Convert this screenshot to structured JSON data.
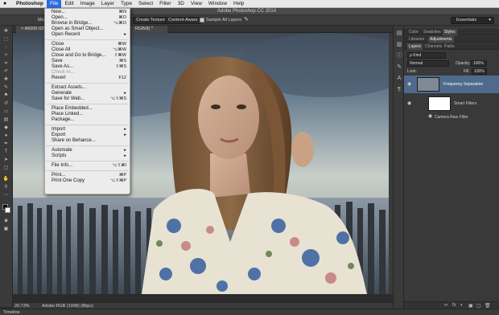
{
  "menubar": {
    "app": "Photoshop",
    "items": [
      "File",
      "Edit",
      "Image",
      "Layer",
      "Type",
      "Select",
      "Filter",
      "3D",
      "View",
      "Window",
      "Help"
    ]
  },
  "window_title": "Adobe Photoshop CC 2014",
  "options": {
    "mode_label": "Mo",
    "texture_button": "Create Texture",
    "content_aware_button": "Content-Aware",
    "sample_all_layers": "Sample All Layers",
    "workspace": "Essentials"
  },
  "document_tab": {
    "title": "A6000-025...",
    "suffix": "RGB/8) *"
  },
  "status": {
    "zoom": "20.73%",
    "profile": "Adobe RGB (1998) (8bpc)"
  },
  "timeline_label": "Timeline",
  "file_menu": {
    "items": [
      {
        "label": "New...",
        "shortcut": "⌘N"
      },
      {
        "label": "Open...",
        "shortcut": "⌘O"
      },
      {
        "label": "Browse in Bridge...",
        "shortcut": "⌥⌘O"
      },
      {
        "label": "Open as Smart Object...",
        "shortcut": ""
      },
      {
        "label": "Open Recent",
        "shortcut": "▸"
      },
      {
        "label": "Close",
        "shortcut": "⌘W"
      },
      {
        "label": "Close All",
        "shortcut": "⌥⌘W"
      },
      {
        "label": "Close and Go to Bridge...",
        "shortcut": "⇧⌘W"
      },
      {
        "label": "Save",
        "shortcut": "⌘S"
      },
      {
        "label": "Save As...",
        "shortcut": "⇧⌘S"
      },
      {
        "label": "Check In...",
        "shortcut": ""
      },
      {
        "label": "Revert",
        "shortcut": "F12"
      },
      {
        "label": "Extract Assets...",
        "shortcut": ""
      },
      {
        "label": "Generate",
        "shortcut": "▸"
      },
      {
        "label": "Save for Web...",
        "shortcut": "⌥⇧⌘S"
      },
      {
        "label": "Place Embedded...",
        "shortcut": ""
      },
      {
        "label": "Place Linked...",
        "shortcut": ""
      },
      {
        "label": "Package...",
        "shortcut": ""
      },
      {
        "label": "Import",
        "shortcut": "▸"
      },
      {
        "label": "Export",
        "shortcut": "▸"
      },
      {
        "label": "Share on Behance...",
        "shortcut": ""
      },
      {
        "label": "Automate",
        "shortcut": "▸"
      },
      {
        "label": "Scripts",
        "shortcut": "▸"
      },
      {
        "label": "File Info...",
        "shortcut": "⌥⇧⌘I"
      },
      {
        "label": "Print...",
        "shortcut": "⌘P"
      },
      {
        "label": "Print One Copy",
        "shortcut": "⌥⇧⌘P"
      }
    ]
  },
  "panels": {
    "top_tabs": [
      "Color",
      "Swatches",
      "Styles"
    ],
    "top_tabs2": [
      "Libraries",
      "Adjustments"
    ],
    "layer_tabs": [
      "Layers",
      "Channels",
      "Paths"
    ],
    "kind_label": "ρ Kind",
    "blend_mode": "Normal",
    "opacity_label": "Opacity:",
    "opacity_value": "100%",
    "lock_label": "Lock:",
    "fill_label": "Fill:",
    "fill_value": "100%",
    "layer_name": "Frequency Separation",
    "smart_filters": "Smart Filters",
    "camera_raw": "Camera Raw Filter",
    "footer_icons": [
      "∞",
      "fx",
      "◐",
      "▣",
      "▢",
      "🗑"
    ]
  }
}
